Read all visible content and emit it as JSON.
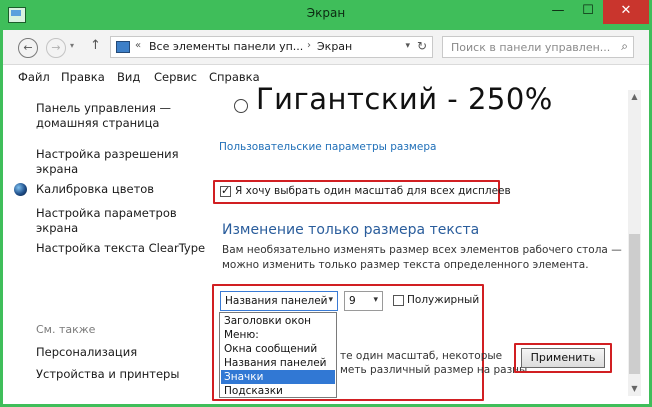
{
  "window": {
    "title": "Экран",
    "minimize": "—",
    "maximize": "☐",
    "close": "✕"
  },
  "nav": {
    "back": "←",
    "forward": "→",
    "dropdown": "▾",
    "up": "↑"
  },
  "address": {
    "chevron1": "«",
    "seg1": "Все элементы панели уп...",
    "chevron2": "›",
    "seg2": "Экран",
    "dropdown": "▾",
    "refresh": "↻"
  },
  "search": {
    "placeholder": "Поиск в панели управлен...",
    "icon": "⌕"
  },
  "menu": {
    "items": [
      "Файл",
      "Правка",
      "Вид",
      "Сервис",
      "Справка"
    ]
  },
  "sidebar": {
    "home": [
      "Панель управления —",
      "домашняя страница"
    ],
    "resolution": [
      "Настройка разрешения",
      "экрана"
    ],
    "calibration": "Калибровка цветов",
    "params": [
      "Настройка параметров",
      "экрана"
    ],
    "cleartype": "Настройка текста ClearType",
    "see_also": "См. также",
    "personalization": "Персонализация",
    "devices": "Устройства и принтеры"
  },
  "main": {
    "giant_option": "Гигантский - 250%",
    "custom_link": "Пользовательские параметры размера",
    "one_scale_checkbox": "Я хочу выбрать один масштаб для всех дисплеев",
    "one_scale_checked": true,
    "text_size_title": "Изменение только размера текста",
    "desc_line1": "Вам необязательно изменять размер всех элементов рабочего стола —",
    "desc_line2": "можно изменить только размер текста определенного элемента.",
    "element_select": "Названия панелей",
    "size_select": "9",
    "bold_label": "Полужирный",
    "bold_checked": false,
    "list_options": [
      "Заголовки окон",
      "Меню:",
      "Окна сообщений",
      "Названия панелей",
      "Значки",
      "Подсказки"
    ],
    "list_selected_index": 4,
    "obscured_line1": "те один масштаб, некоторые",
    "obscured_line2": "меть различный размер на разны",
    "apply_button": "Применить"
  },
  "scrollbar": {
    "up": "▲",
    "down": "▼"
  },
  "colors": {
    "window_frame": "#3fbe5a",
    "highlight_box": "#d11f22",
    "selection": "#3178d4",
    "link": "#1f6fb8"
  }
}
